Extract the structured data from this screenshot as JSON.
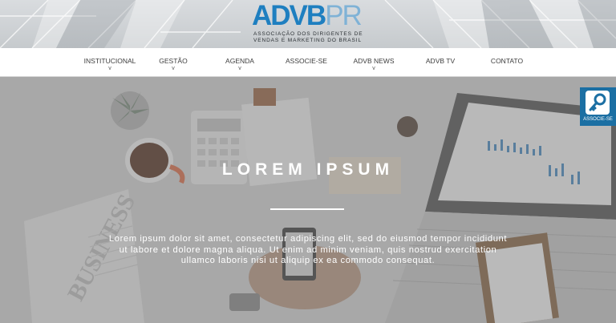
{
  "brand": {
    "logo_strong": "ADVB",
    "logo_light": "PR",
    "tagline_line1": "ASSOCIAÇÃO DOS DIRIGENTES DE",
    "tagline_line2": "VENDAS E MARKETING DO BRASIL",
    "logo_color": "#1e7fc0"
  },
  "nav": {
    "items": [
      {
        "label": "INSTITUCIONAL",
        "dropdown": "v"
      },
      {
        "label": "GESTÃO",
        "dropdown": "v"
      },
      {
        "label": "AGENDA",
        "dropdown": "v"
      },
      {
        "label": "ASSOCIE-SE",
        "dropdown": ""
      },
      {
        "label": "ADVB NEWS",
        "dropdown": "v"
      },
      {
        "label": "ADVB TV",
        "dropdown": ""
      },
      {
        "label": "CONTATO",
        "dropdown": ""
      }
    ]
  },
  "hero": {
    "title": "LOREM IPSUM",
    "text": "Lorem ipsum dolor sit amet, consectetur adipiscing elit, sed do eiusmod tempor incididunt ut labore et dolore magna aliqua. Ut enim ad minim veniam, quis nostrud exercitation ullamco laboris nisi ut aliquip ex ea commodo consequat.",
    "newspaper_word": "BUSINESS"
  },
  "floating_button": {
    "label": "ASSOCIE-SE",
    "icon": "key-icon",
    "color": "#1b6fa3"
  }
}
